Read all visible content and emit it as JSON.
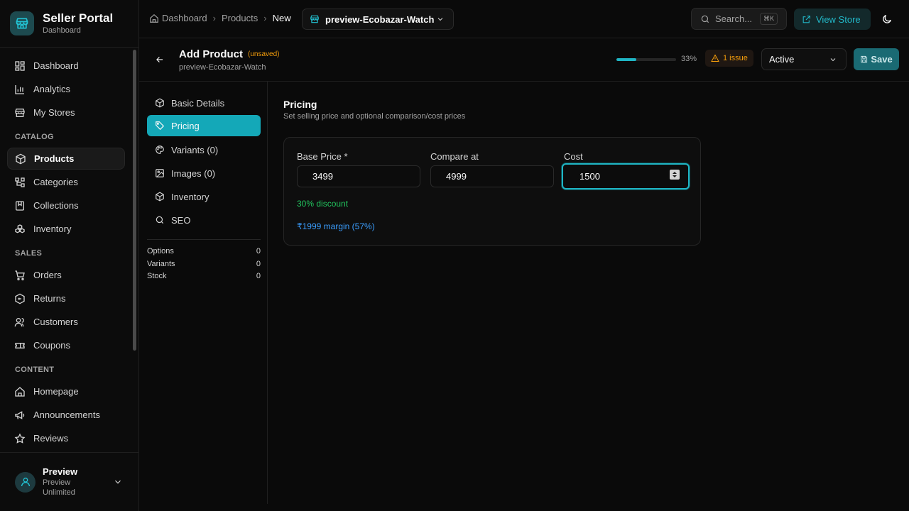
{
  "brand": {
    "title": "Seller Portal",
    "subtitle": "Dashboard"
  },
  "sidebar": {
    "top_items": [
      {
        "label": "Dashboard",
        "icon": "dashboard-icon"
      },
      {
        "label": "Analytics",
        "icon": "bar-chart-icon"
      },
      {
        "label": "My Stores",
        "icon": "store-icon"
      }
    ],
    "catalog_heading": "CATALOG",
    "catalog_items": [
      {
        "label": "Products",
        "icon": "box-icon",
        "active": true
      },
      {
        "label": "Categories",
        "icon": "tree-icon"
      },
      {
        "label": "Collections",
        "icon": "bookmark-icon"
      },
      {
        "label": "Inventory",
        "icon": "boxes-icon"
      }
    ],
    "sales_heading": "SALES",
    "sales_items": [
      {
        "label": "Orders",
        "icon": "cart-icon"
      },
      {
        "label": "Returns",
        "icon": "return-box-icon"
      },
      {
        "label": "Customers",
        "icon": "users-icon"
      },
      {
        "label": "Coupons",
        "icon": "ticket-icon"
      }
    ],
    "content_heading": "CONTENT",
    "content_items": [
      {
        "label": "Homepage",
        "icon": "home-icon"
      },
      {
        "label": "Announcements",
        "icon": "megaphone-icon"
      },
      {
        "label": "Reviews",
        "icon": "star-icon"
      }
    ]
  },
  "user": {
    "name": "Preview",
    "plan": "Preview Unlimited"
  },
  "topbar": {
    "breadcrumbs": [
      "Dashboard",
      "Products",
      "New"
    ],
    "store": "preview-Ecobazar-Watch",
    "search_placeholder": "Search...",
    "search_shortcut": "⌘K",
    "view_store": "View Store"
  },
  "header": {
    "title": "Add Product",
    "unsaved": "(unsaved)",
    "subtitle": "preview-Ecobazar-Watch",
    "progress": 0.33,
    "progress_label": "33%",
    "issues": "1 issue",
    "status": "Active",
    "save": "Save"
  },
  "sections": [
    {
      "label": "Basic Details",
      "icon": "box-icon"
    },
    {
      "label": "Pricing",
      "icon": "tag-icon",
      "active": true
    },
    {
      "label": "Variants (0)",
      "icon": "palette-icon"
    },
    {
      "label": "Images (0)",
      "icon": "image-icon"
    },
    {
      "label": "Inventory",
      "icon": "boxes-icon"
    },
    {
      "label": "SEO",
      "icon": "search-icon"
    }
  ],
  "stats": [
    {
      "label": "Options",
      "value": "0"
    },
    {
      "label": "Variants",
      "value": "0"
    },
    {
      "label": "Stock",
      "value": "0"
    }
  ],
  "pricing": {
    "title": "Pricing",
    "subtitle": "Set selling price and optional comparison/cost prices",
    "base_label": "Base Price *",
    "base_value": "3499",
    "compare_label": "Compare at",
    "compare_value": "4999",
    "cost_label": "Cost",
    "cost_value": "1500",
    "discount": "30% discount",
    "margin": "₹1999 margin (57%)"
  },
  "colors": {
    "accent": "#14a8b8",
    "warning": "#f59e0b",
    "success": "#22c55e",
    "info": "#3b9eff"
  }
}
